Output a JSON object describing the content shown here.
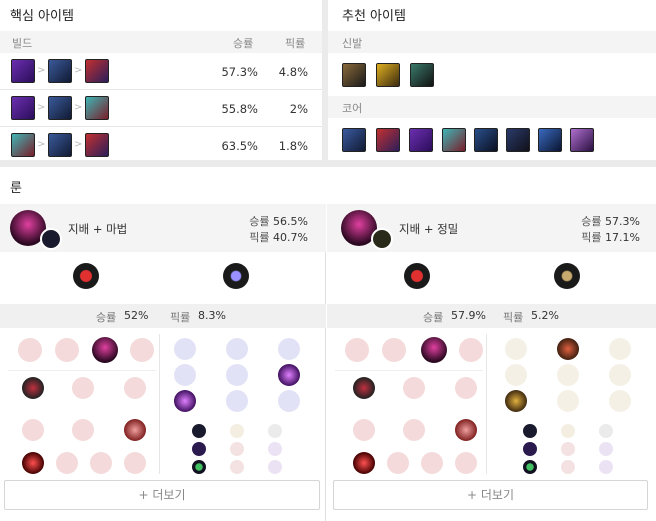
{
  "core_items": {
    "title": "핵심 아이템",
    "header": {
      "build": "빌드",
      "winrate": "승률",
      "pickrate": "픽률"
    },
    "rows": [
      {
        "items": [
          "rylai-icon",
          "boots-icon",
          "ludens-icon"
        ],
        "winrate": "57.3%",
        "pickrate": "4.8%"
      },
      {
        "items": [
          "rylai-icon",
          "boots-icon",
          "liandry-icon"
        ],
        "winrate": "55.8%",
        "pickrate": "2%"
      },
      {
        "items": [
          "liandry-icon",
          "boots-icon",
          "ludens-icon"
        ],
        "winrate": "63.5%",
        "pickrate": "1.8%"
      }
    ]
  },
  "recommended_items": {
    "title": "추천 아이템",
    "boots_label": "신발",
    "core_label": "코어",
    "boots": [
      "sorcerer-shoes-icon",
      "mercury-treads-icon",
      "ninja-tabi-icon"
    ],
    "core": [
      "ludens-icon",
      "ludens-icon",
      "rylai-icon",
      "liandry-icon",
      "void-staff-icon",
      "zhonya-icon",
      "staff-icon",
      "morello-icon"
    ]
  },
  "runes": {
    "title": "룬",
    "more_label": "+ 더보기",
    "pages": [
      {
        "name": "지배 + 마법",
        "winrate_label": "승률",
        "winrate": "56.5%",
        "pickrate_label": "픽률",
        "pickrate": "40.7%",
        "primary_tree": "domination-icon",
        "secondary_tree": "sorcery-icon",
        "shard_win_label": "승률",
        "shard_winrate": "52%",
        "shard_pick_label": "픽률",
        "shard_pickrate": "8.3%"
      },
      {
        "name": "지배 + 정밀",
        "winrate_label": "승률",
        "winrate": "57.3%",
        "pickrate_label": "픽률",
        "pickrate": "17.1%",
        "primary_tree": "domination-icon",
        "secondary_tree": "precision-icon",
        "shard_win_label": "승률",
        "shard_winrate": "57.9%",
        "shard_pick_label": "픽률",
        "shard_pickrate": "5.2%"
      }
    ]
  }
}
